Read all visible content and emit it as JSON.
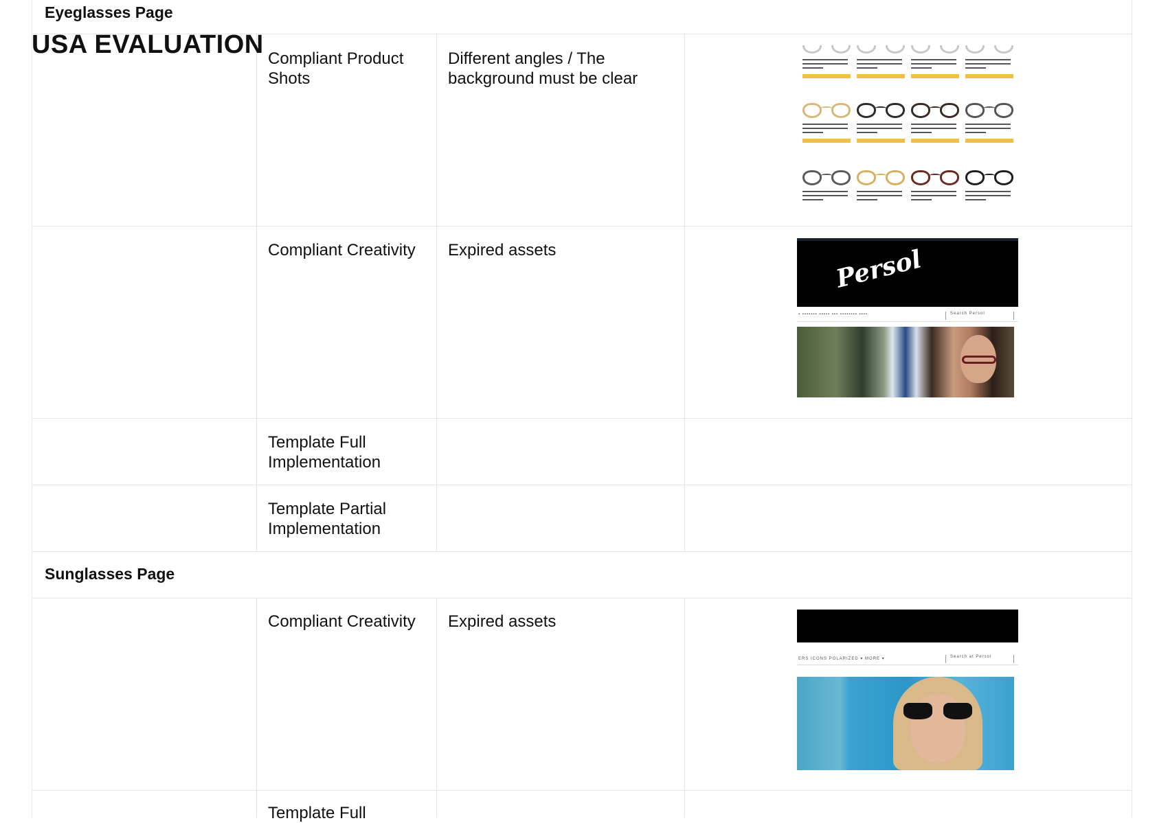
{
  "main_title": "USA EVALUATION",
  "sections": {
    "eyeglasses": {
      "title": "Eyeglasses Page",
      "rows": [
        {
          "criterion": "Compliant Product\nShots",
          "description": "Different angles / The\nbackground must be clear",
          "screenshot": "product-grid-screenshot"
        },
        {
          "criterion": "Compliant Creativity",
          "description": "Expired assets",
          "screenshot": "persol-banner-screenshot"
        },
        {
          "criterion": "Template Full\nImplementation",
          "description": ""
        },
        {
          "criterion": "Template Partial\nImplementation",
          "description": ""
        }
      ]
    },
    "sunglasses": {
      "title": "Sunglasses Page",
      "rows": [
        {
          "criterion": "Compliant Creativity",
          "description": "Expired assets",
          "screenshot": "sunglasses-banner-screenshot"
        },
        {
          "criterion": "Template Full",
          "description": ""
        }
      ]
    }
  },
  "screenshots": {
    "persol_logo": "Persol",
    "nav_search_1": "Search Persol",
    "nav_search_2": "Search at Persol",
    "nav_links_2": "ERS   ICONS   POLARIZED ▾   MORE ▾",
    "product_frame_colors": [
      "#c8c8c8",
      "#c8c8c8",
      "#c8c8c8",
      "#c8c8c8",
      "#d8b878",
      "#2b2b2b",
      "#3a2a24",
      "#555555",
      "#5a5a5a",
      "#d8b060",
      "#6a2a22",
      "#1e1e1e"
    ]
  },
  "colors": {
    "grid_line": "#e3e6ea",
    "button_yellow": "#f0c040"
  }
}
